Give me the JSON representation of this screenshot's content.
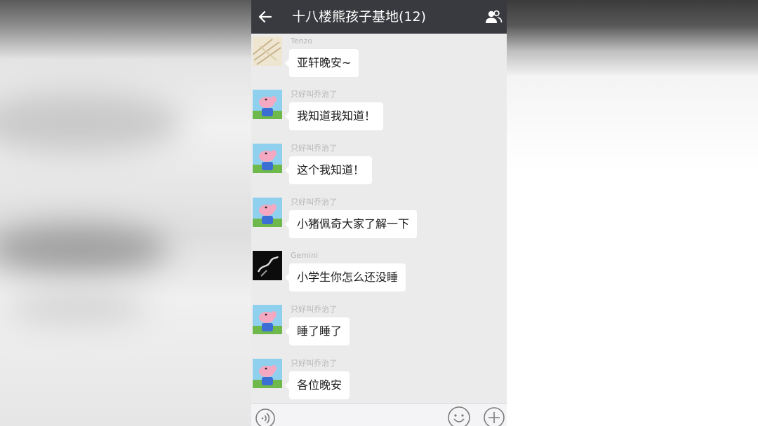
{
  "header": {
    "title": "十八楼熊孩子基地(12)",
    "back_icon": "arrow-left-icon",
    "members_icon": "group-members-icon",
    "background_color": "#393a3f"
  },
  "messages": [
    {
      "sender": "Tenzo",
      "text": "亚轩晚安~",
      "avatar": "beige-sketch-avatar"
    },
    {
      "sender": "只好叫乔治了",
      "text": "我知道我知道！",
      "avatar": "peppa-pig-avatar"
    },
    {
      "sender": "只好叫乔治了",
      "text": "这个我知道！",
      "avatar": "peppa-pig-avatar"
    },
    {
      "sender": "只好叫乔治了",
      "text": "小猪佩奇大家了解一下",
      "avatar": "peppa-pig-avatar"
    },
    {
      "sender": "Gemini",
      "text": "小学生你怎么还没睡",
      "avatar": "dark-photo-avatar"
    },
    {
      "sender": "只好叫乔治了",
      "text": "睡了睡了",
      "avatar": "peppa-pig-avatar"
    },
    {
      "sender": "只好叫乔治了",
      "text": "各位晚安",
      "avatar": "peppa-pig-avatar"
    }
  ],
  "input_bar": {
    "voice_icon": "voice-icon",
    "emoji_icon": "emoji-icon",
    "plus_icon": "plus-icon"
  },
  "colors": {
    "chat_background": "#ebebeb",
    "bubble": "#ffffff",
    "sender_name": "#b5b5b5"
  }
}
